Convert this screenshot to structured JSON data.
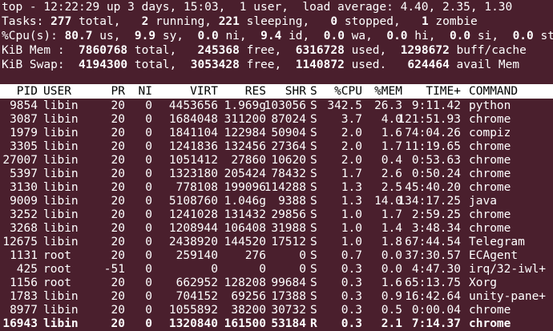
{
  "summary": {
    "line1": "top - 12:22:29 up 3 days, 15:03,  1 user,  load average: 4.40, 2.35, 1.30",
    "tasks": {
      "label": "Tasks:",
      "total": "277",
      "total_label": "total,",
      "running": "2",
      "running_label": "running,",
      "sleeping": "221",
      "sleeping_label": "sleeping,",
      "stopped": "0",
      "stopped_label": "stopped,",
      "zombie": "1",
      "zombie_label": "zombie"
    },
    "cpu": {
      "label": "%Cpu(s):",
      "us": "80.7",
      "us_label": "us,",
      "sy": "9.9",
      "sy_label": "sy,",
      "ni": "0.0",
      "ni_label": "ni,",
      "id": "9.4",
      "id_label": "id,",
      "wa": "0.0",
      "wa_label": "wa,",
      "hi": "0.0",
      "hi_label": "hi,",
      "si": "0.0",
      "si_label": "si,",
      "st": "0.0",
      "st_label": "st"
    },
    "mem": {
      "label": "KiB Mem :",
      "total": "7860768",
      "total_label": "total,",
      "free": "245368",
      "free_label": "free,",
      "used": "6316728",
      "used_label": "used,",
      "buff": "1298672",
      "buff_label": "buff/cache"
    },
    "swap": {
      "label": "KiB Swap:",
      "total": "4194300",
      "total_label": "total,",
      "free": "3053428",
      "free_label": "free,",
      "used": "1140872",
      "used_label": "used.",
      "avail": "624464",
      "avail_label": "avail Mem"
    }
  },
  "columns": [
    "PID",
    "USER",
    "PR",
    "NI",
    "VIRT",
    "RES",
    "SHR",
    "S",
    "%CPU",
    "%MEM",
    "TIME+",
    "COMMAND"
  ],
  "processes": [
    [
      "9854",
      "libin",
      "20",
      "0",
      "4453656",
      "1.969g",
      "103056",
      "S",
      "342.5",
      "26.3",
      "9:11.42",
      "python"
    ],
    [
      "3087",
      "libin",
      "20",
      "0",
      "1684048",
      "311200",
      "87024",
      "S",
      "3.7",
      "4.0",
      "121:51.93",
      "chrome"
    ],
    [
      "1979",
      "libin",
      "20",
      "0",
      "1841104",
      "122984",
      "50904",
      "S",
      "2.0",
      "1.6",
      "74:04.26",
      "compiz"
    ],
    [
      "3305",
      "libin",
      "20",
      "0",
      "1241836",
      "132456",
      "27364",
      "S",
      "2.0",
      "1.7",
      "11:19.65",
      "chrome"
    ],
    [
      "27007",
      "libin",
      "20",
      "0",
      "1051412",
      "27860",
      "10620",
      "S",
      "2.0",
      "0.4",
      "0:53.63",
      "chrome"
    ],
    [
      "5397",
      "libin",
      "20",
      "0",
      "1323180",
      "205424",
      "78432",
      "S",
      "1.7",
      "2.6",
      "0:50.24",
      "chrome"
    ],
    [
      "3130",
      "libin",
      "20",
      "0",
      "778108",
      "199096",
      "114288",
      "S",
      "1.3",
      "2.5",
      "45:40.20",
      "chrome"
    ],
    [
      "9009",
      "libin",
      "20",
      "0",
      "5108760",
      "1.046g",
      "9388",
      "S",
      "1.3",
      "14.0",
      "134:17.25",
      "java"
    ],
    [
      "3252",
      "libin",
      "20",
      "0",
      "1241028",
      "131432",
      "29856",
      "S",
      "1.0",
      "1.7",
      "2:59.25",
      "chrome"
    ],
    [
      "3268",
      "libin",
      "20",
      "0",
      "1208944",
      "106408",
      "31988",
      "S",
      "1.0",
      "1.4",
      "3:48.34",
      "chrome"
    ],
    [
      "12675",
      "libin",
      "20",
      "0",
      "2438920",
      "144520",
      "17512",
      "S",
      "1.0",
      "1.8",
      "67:44.54",
      "Telegram"
    ],
    [
      "1131",
      "root",
      "20",
      "0",
      "259140",
      "276",
      "0",
      "S",
      "0.7",
      "0.0",
      "37:30.57",
      "ECAgent"
    ],
    [
      "425",
      "root",
      "-51",
      "0",
      "0",
      "0",
      "0",
      "S",
      "0.3",
      "0.0",
      "4:47.30",
      "irq/32-iwl+"
    ],
    [
      "1156",
      "root",
      "20",
      "0",
      "662952",
      "128208",
      "99684",
      "S",
      "0.3",
      "1.6",
      "65:13.75",
      "Xorg"
    ],
    [
      "1783",
      "libin",
      "20",
      "0",
      "704152",
      "69256",
      "17388",
      "S",
      "0.3",
      "0.9",
      "16:42.64",
      "unity-pane+"
    ],
    [
      "8977",
      "libin",
      "20",
      "0",
      "1055892",
      "38200",
      "30732",
      "S",
      "0.3",
      "0.5",
      "0:00.04",
      "chrome"
    ],
    [
      "16943",
      "libin",
      "20",
      "0",
      "1320840",
      "161500",
      "53184",
      "R",
      "0.3",
      "2.1",
      "7:14.37",
      "chrome"
    ]
  ],
  "bold_row_index": 16
}
